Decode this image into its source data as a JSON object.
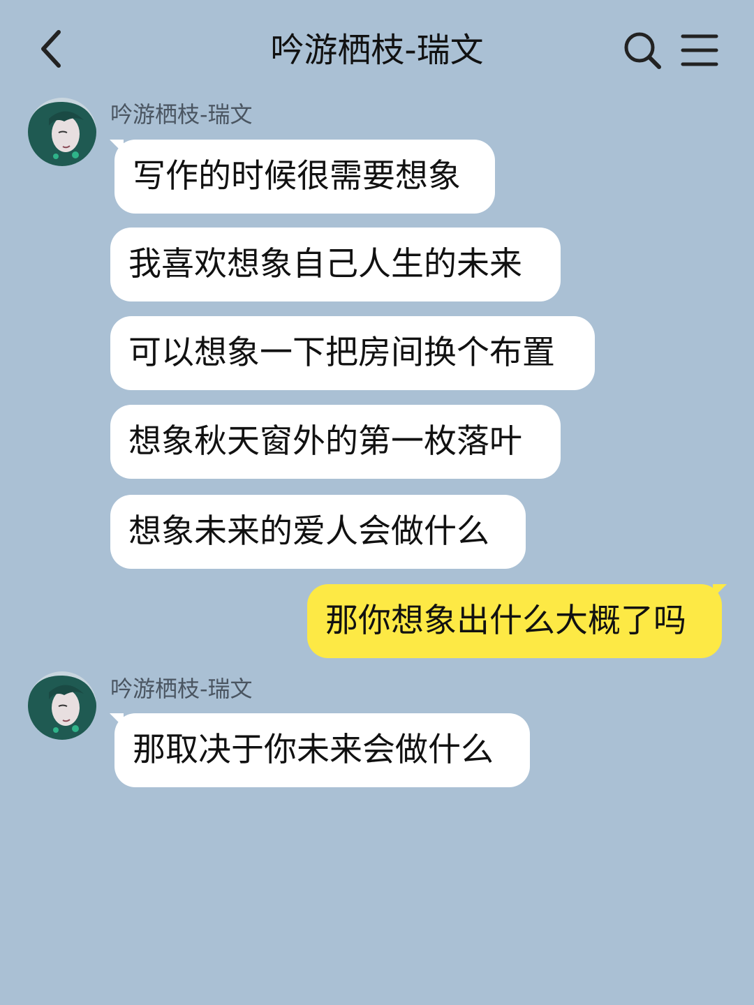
{
  "header": {
    "title": "吟游栖枝-瑞文",
    "back_icon": "chevron-left-icon",
    "search_icon": "search-icon",
    "menu_icon": "hamburger-menu-icon"
  },
  "colors": {
    "background": "#aac0d4",
    "incoming_bubble": "#ffffff",
    "outgoing_bubble": "#fde945",
    "avatar_hair": "#1f5a52"
  },
  "messages": [
    {
      "sender": "吟游栖枝-瑞文",
      "direction": "incoming",
      "bubbles": [
        "写作的时候很需要想象",
        "我喜欢想象自己人生的未来",
        "可以想象一下把房间换个布置",
        "想象秋天窗外的第一枚落叶",
        "想象未来的爱人会做什么"
      ]
    },
    {
      "direction": "outgoing",
      "bubbles": [
        "那你想象出什么大概了吗"
      ]
    },
    {
      "sender": "吟游栖枝-瑞文",
      "direction": "incoming",
      "bubbles": [
        "那取决于你未来会做什么"
      ]
    }
  ]
}
